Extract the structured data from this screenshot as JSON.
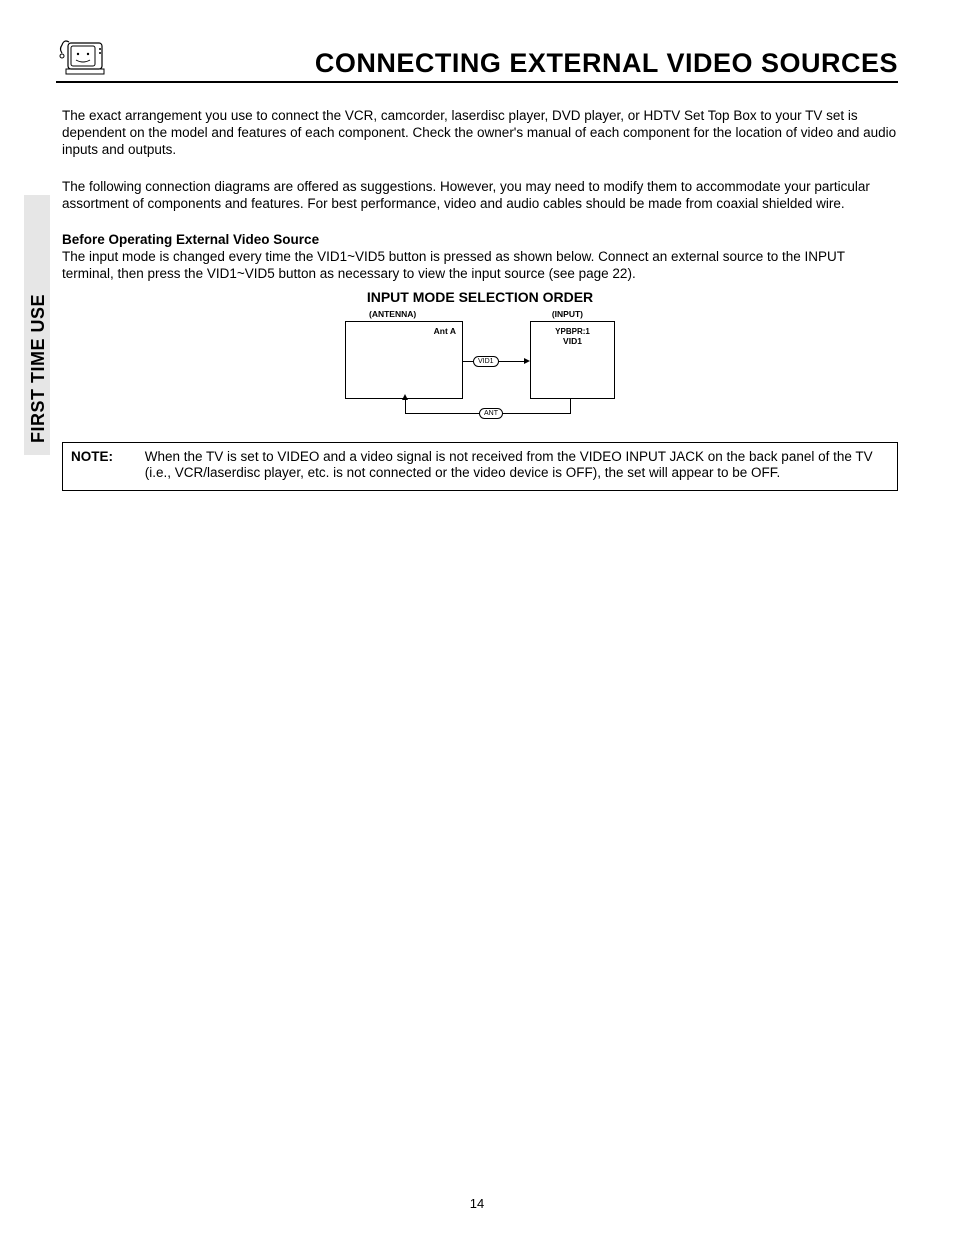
{
  "header": {
    "title": "CONNECTING EXTERNAL VIDEO SOURCES"
  },
  "sidebar": {
    "label": "FIRST TIME USE"
  },
  "body": {
    "para1": "The exact arrangement you use to connect the VCR, camcorder, laserdisc player, DVD player, or HDTV Set Top Box to your TV set is dependent on the model and features of each component.  Check the owner's manual of each component for the location of video and audio inputs and outputs.",
    "para2": "The following connection diagrams are offered as suggestions.  However, you may need to modify them to accommodate your particular assortment of components and features.  For best performance, video and audio cables should be made from coaxial shielded wire.",
    "subhead": "Before Operating External Video Source",
    "para3": "The input mode is changed every time the VID1~VID5 button is pressed as shown below.  Connect an external source to the INPUT terminal, then press the VID1~VID5 button as necessary to view the input source (see page 22)."
  },
  "diagram": {
    "title": "INPUT MODE SELECTION ORDER",
    "left_heading": "(ANTENNA)",
    "right_heading": "(INPUT)",
    "left_box": "Ant A",
    "right_box_line1": "YPBPR:1",
    "right_box_line2": "VID1",
    "pill_vid": "VID1",
    "pill_ant": "ANT"
  },
  "note": {
    "label": "NOTE:",
    "text": "When the TV is set to VIDEO and a video signal is not received from the VIDEO INPUT JACK on the back panel of the TV (i.e., VCR/laserdisc player, etc. is not connected or the video device is OFF), the set will appear to be OFF."
  },
  "page_number": "14"
}
